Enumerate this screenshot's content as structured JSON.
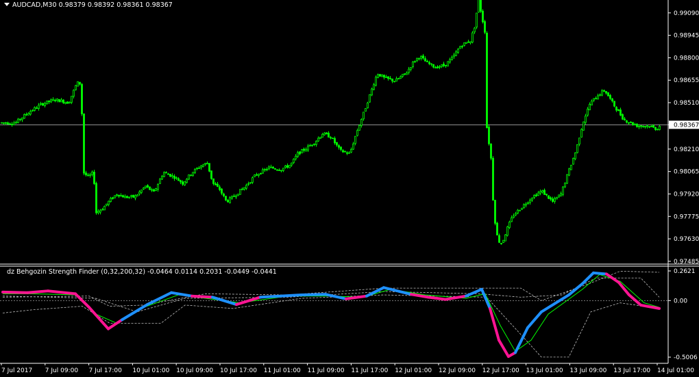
{
  "main_window": {
    "symbol_label": "AUDCAD,M30",
    "ohlc": [
      "0.98379",
      "0.98392",
      "0.98361",
      "0.98367"
    ]
  },
  "indicator_window": {
    "label": "dz Behgozin Strength Finder (0,32,200,32)",
    "values": [
      "-0.0464",
      "0.0114",
      "0.2031",
      "-0.0449",
      "-0.0441"
    ]
  },
  "colors": {
    "background": "#000000",
    "candle": "#00ff00",
    "axis": "#ffffff",
    "current_price_line": "#c0c0c0",
    "strength_up": "#1e90ff",
    "strength_down": "#ff1493",
    "signal_line": "#00ff00",
    "bands": "#c0c0c0"
  },
  "chart_data": [
    {
      "type": "candlestick",
      "title": "AUDCAD,M30",
      "ylim": [
        0.9748,
        0.9916
      ],
      "yticks": [
        "0.99090",
        "0.98945",
        "0.98800",
        "0.98655",
        "0.98510",
        "0.98367",
        "0.98210",
        "0.98065",
        "0.97920",
        "0.97775",
        "0.97630",
        "0.97485"
      ],
      "current_price": "0.98367",
      "close_path": [
        [
          0,
          0.9838
        ],
        [
          22,
          0.9838
        ],
        [
          42,
          0.9845
        ],
        [
          60,
          0.985
        ],
        [
          80,
          0.9853
        ],
        [
          100,
          0.9851
        ],
        [
          112,
          0.9864
        ],
        [
          118,
          0.9863
        ],
        [
          121,
          0.9806
        ],
        [
          128,
          0.9803
        ],
        [
          136,
          0.9806
        ],
        [
          140,
          0.978
        ],
        [
          150,
          0.9783
        ],
        [
          160,
          0.9788
        ],
        [
          170,
          0.9792
        ],
        [
          182,
          0.979
        ],
        [
          196,
          0.979
        ],
        [
          212,
          0.9797
        ],
        [
          224,
          0.9793
        ],
        [
          238,
          0.9806
        ],
        [
          254,
          0.9803
        ],
        [
          266,
          0.9799
        ],
        [
          280,
          0.9806
        ],
        [
          292,
          0.981
        ],
        [
          302,
          0.9812
        ],
        [
          310,
          0.9799
        ],
        [
          320,
          0.9795
        ],
        [
          330,
          0.9787
        ],
        [
          342,
          0.9791
        ],
        [
          358,
          0.9797
        ],
        [
          372,
          0.9804
        ],
        [
          392,
          0.9809
        ],
        [
          410,
          0.9808
        ],
        [
          424,
          0.9811
        ],
        [
          434,
          0.9818
        ],
        [
          448,
          0.9822
        ],
        [
          460,
          0.9826
        ],
        [
          470,
          0.9831
        ],
        [
          482,
          0.9829
        ],
        [
          496,
          0.982
        ],
        [
          510,
          0.9818
        ],
        [
          520,
          0.9832
        ],
        [
          530,
          0.9844
        ],
        [
          540,
          0.9857
        ],
        [
          550,
          0.987
        ],
        [
          560,
          0.9867
        ],
        [
          576,
          0.9865
        ],
        [
          592,
          0.987
        ],
        [
          604,
          0.9878
        ],
        [
          612,
          0.9881
        ],
        [
          622,
          0.9877
        ],
        [
          634,
          0.9874
        ],
        [
          648,
          0.9875
        ],
        [
          660,
          0.988
        ],
        [
          672,
          0.9888
        ],
        [
          686,
          0.9891
        ],
        [
          692,
          0.99
        ],
        [
          698,
          0.9918
        ],
        [
          702,
          0.9908
        ],
        [
          708,
          0.9895
        ],
        [
          710,
          0.9835
        ],
        [
          716,
          0.9815
        ],
        [
          720,
          0.978
        ],
        [
          726,
          0.9762
        ],
        [
          732,
          0.976
        ],
        [
          740,
          0.977
        ],
        [
          748,
          0.9778
        ],
        [
          762,
          0.9784
        ],
        [
          776,
          0.979
        ],
        [
          790,
          0.9794
        ],
        [
          806,
          0.9787
        ],
        [
          818,
          0.9792
        ],
        [
          828,
          0.9805
        ],
        [
          840,
          0.982
        ],
        [
          850,
          0.9838
        ],
        [
          860,
          0.985
        ],
        [
          872,
          0.9856
        ],
        [
          882,
          0.9859
        ],
        [
          896,
          0.9849
        ],
        [
          910,
          0.984
        ],
        [
          930,
          0.9836
        ],
        [
          946,
          0.9836
        ],
        [
          958,
          0.9834
        ],
        [
          964,
          0.9837
        ]
      ]
    },
    {
      "type": "line",
      "title": "dz Behgozin Strength Finder (0,32,200,32)",
      "ylim": [
        -0.5006,
        0.2621
      ],
      "yticks": [
        "0.2621",
        "0.00",
        "-0.5006"
      ],
      "series": [
        {
          "role": "strength",
          "points": [
            [
              4,
              0.075
            ],
            [
              40,
              0.07
            ],
            [
              70,
              0.085
            ],
            [
              110,
              0.06
            ],
            [
              130,
              -0.06
            ],
            [
              158,
              -0.25
            ],
            [
              178,
              -0.17
            ],
            [
              215,
              -0.035
            ],
            [
              250,
              0.07
            ],
            [
              280,
              0.04
            ],
            [
              310,
              0.03
            ],
            [
              345,
              -0.035
            ],
            [
              380,
              0.03
            ],
            [
              440,
              0.05
            ],
            [
              475,
              0.055
            ],
            [
              505,
              0.015
            ],
            [
              535,
              0.04
            ],
            [
              560,
              0.115
            ],
            [
              600,
              0.055
            ],
            [
              625,
              0.03
            ],
            [
              650,
              0.01
            ],
            [
              680,
              0.04
            ],
            [
              703,
              0.1
            ],
            [
              715,
              -0.07
            ],
            [
              728,
              -0.35
            ],
            [
              742,
              -0.495
            ],
            [
              752,
              -0.46
            ],
            [
              770,
              -0.24
            ],
            [
              790,
              -0.1
            ],
            [
              830,
              0.05
            ],
            [
              850,
              0.15
            ],
            [
              866,
              0.245
            ],
            [
              885,
              0.235
            ],
            [
              903,
              0.16
            ],
            [
              918,
              0.05
            ],
            [
              935,
              -0.04
            ],
            [
              962,
              -0.07
            ]
          ],
          "direction": [
            "down",
            "down",
            "down",
            "down",
            "down",
            "down",
            "up",
            "up",
            "up",
            "down",
            "up",
            "down",
            "up",
            "up",
            "up",
            "down",
            "up",
            "up",
            "down",
            "down",
            "down",
            "up",
            "up",
            "down",
            "down",
            "down",
            "up",
            "up",
            "up",
            "up",
            "up",
            "up",
            "down",
            "down",
            "down",
            "down"
          ]
        },
        {
          "role": "signal",
          "points": [
            [
              4,
              0.06
            ],
            [
              50,
              0.06
            ],
            [
              110,
              0.05
            ],
            [
              140,
              -0.12
            ],
            [
              170,
              -0.2
            ],
            [
              210,
              -0.06
            ],
            [
              260,
              0.05
            ],
            [
              300,
              0.02
            ],
            [
              350,
              -0.02
            ],
            [
              420,
              0.04
            ],
            [
              480,
              0.04
            ],
            [
              530,
              0.03
            ],
            [
              570,
              0.1
            ],
            [
              620,
              0.05
            ],
            [
              680,
              0.02
            ],
            [
              708,
              0.06
            ],
            [
              730,
              -0.22
            ],
            [
              752,
              -0.45
            ],
            [
              775,
              -0.35
            ],
            [
              800,
              -0.12
            ],
            [
              850,
              0.1
            ],
            [
              875,
              0.23
            ],
            [
              905,
              0.17
            ],
            [
              940,
              -0.02
            ],
            [
              962,
              -0.06
            ]
          ]
        },
        {
          "role": "band-upper",
          "points": [
            [
              4,
              0.03
            ],
            [
              130,
              0.04
            ],
            [
              160,
              -0.05
            ],
            [
              210,
              -0.04
            ],
            [
              300,
              0.06
            ],
            [
              420,
              0.05
            ],
            [
              560,
              0.11
            ],
            [
              700,
              0.11
            ],
            [
              760,
              0.11
            ],
            [
              790,
              0.0
            ],
            [
              860,
              0.15
            ],
            [
              905,
              0.26
            ],
            [
              962,
              0.25
            ]
          ]
        },
        {
          "role": "band-lower",
          "points": [
            [
              4,
              -0.11
            ],
            [
              50,
              -0.08
            ],
            [
              120,
              -0.05
            ],
            [
              160,
              -0.2
            ],
            [
              235,
              -0.2
            ],
            [
              270,
              -0.04
            ],
            [
              340,
              -0.07
            ],
            [
              440,
              0.02
            ],
            [
              560,
              0.05
            ],
            [
              710,
              0.03
            ],
            [
              760,
              -0.3
            ],
            [
              790,
              -0.5
            ],
            [
              830,
              -0.5
            ],
            [
              862,
              -0.1
            ],
            [
              905,
              -0.02
            ],
            [
              962,
              -0.07
            ]
          ]
        },
        {
          "role": "band-mid",
          "points": [
            [
              4,
              0.04
            ],
            [
              140,
              0.02
            ],
            [
              200,
              -0.1
            ],
            [
              270,
              0.02
            ],
            [
              420,
              0.03
            ],
            [
              560,
              0.08
            ],
            [
              700,
              0.06
            ],
            [
              760,
              0.03
            ],
            [
              820,
              0.05
            ],
            [
              870,
              0.2
            ],
            [
              935,
              0.2
            ],
            [
              962,
              0.03
            ]
          ]
        }
      ]
    }
  ],
  "time_axis": [
    "7 Jul 2017",
    "7 Jul 09:00",
    "7 Jul 17:00",
    "10 Jul 01:00",
    "10 Jul 09:00",
    "10 Jul 17:00",
    "11 Jul 01:00",
    "11 Jul 09:00",
    "11 Jul 17:00",
    "12 Jul 01:00",
    "12 Jul 09:00",
    "12 Jul 17:00",
    "13 Jul 01:00",
    "13 Jul 09:00",
    "13 Jul 17:00",
    "14 Jul 01:00"
  ]
}
